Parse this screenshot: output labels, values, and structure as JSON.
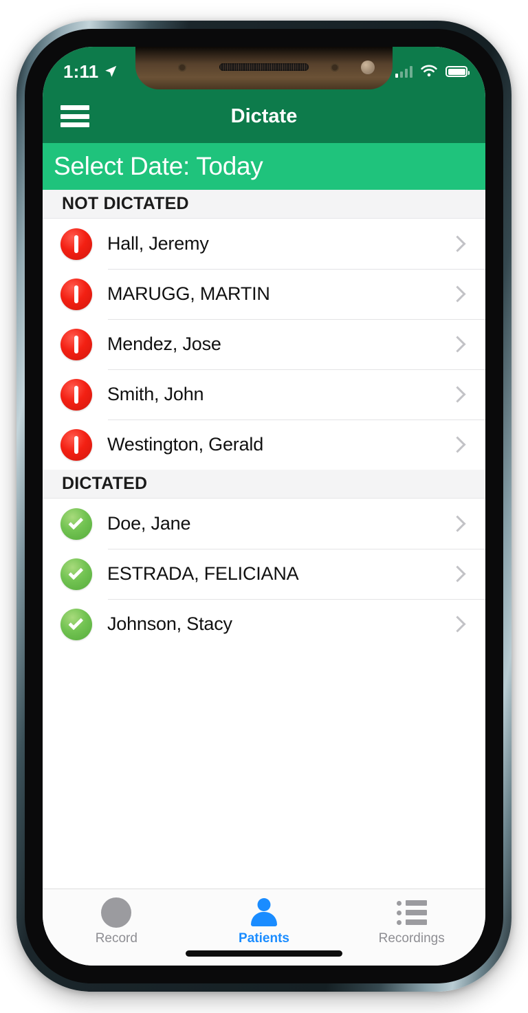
{
  "status_bar": {
    "time": "1:11",
    "location_icon": "location-arrow-icon",
    "signal_icon": "cellular-signal-icon",
    "wifi_icon": "wifi-icon",
    "battery_icon": "battery-full-icon"
  },
  "nav_bar": {
    "menu_icon": "hamburger-menu-icon",
    "title": "Dictate"
  },
  "date_bar": {
    "label": "Select Date: Today"
  },
  "sections": [
    {
      "header": "NOT DICTATED",
      "status_icon": "alert-exclamation-icon",
      "rows": [
        {
          "name": "Hall, Jeremy"
        },
        {
          "name": "MARUGG, MARTIN"
        },
        {
          "name": "Mendez, Jose"
        },
        {
          "name": "Smith, John"
        },
        {
          "name": "Westington, Gerald"
        }
      ]
    },
    {
      "header": "DICTATED",
      "status_icon": "check-circle-icon",
      "rows": [
        {
          "name": "Doe, Jane"
        },
        {
          "name": "ESTRADA, FELICIANA"
        },
        {
          "name": "Johnson, Stacy"
        }
      ]
    }
  ],
  "tab_bar": {
    "tabs": [
      {
        "label": "Record",
        "icon": "record-circle-icon",
        "active": false
      },
      {
        "label": "Patients",
        "icon": "person-icon",
        "active": true
      },
      {
        "label": "Recordings",
        "icon": "list-bullet-icon",
        "active": false
      }
    ]
  },
  "colors": {
    "nav_green": "#0d7b4b",
    "date_green": "#1fc37c",
    "alert_red": "#f32013",
    "done_green": "#72c352",
    "active_blue": "#1a8cff",
    "inactive_gray": "#8e8e93"
  }
}
